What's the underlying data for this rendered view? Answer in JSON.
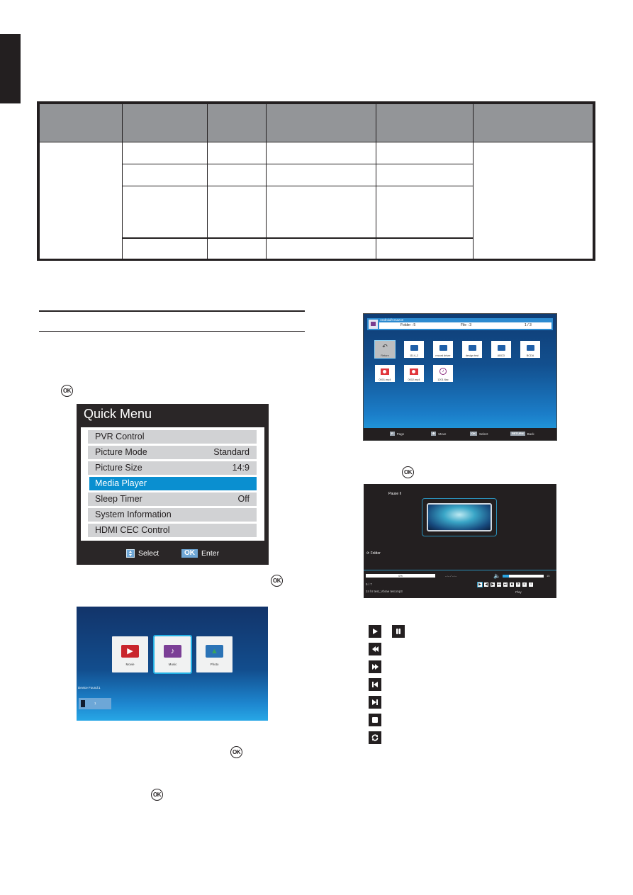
{
  "spec_table": {
    "columns": 6,
    "header": [
      "",
      "",
      "",
      "",
      "",
      ""
    ],
    "rows": [
      [
        "",
        "",
        "",
        "",
        "",
        ""
      ],
      [
        "",
        "",
        "",
        ""
      ],
      [
        "",
        "",
        "",
        ""
      ],
      [
        "",
        "",
        "",
        ""
      ]
    ]
  },
  "quick_menu": {
    "title": "Quick Menu",
    "items": [
      {
        "label": "PVR Control",
        "value": ""
      },
      {
        "label": "Picture Mode",
        "value": "Standard"
      },
      {
        "label": "Picture Size",
        "value": "14:9"
      },
      {
        "label": "Media Player",
        "value": "",
        "selected": true
      },
      {
        "label": "Sleep Timer",
        "value": "Off"
      },
      {
        "label": "System Information",
        "value": ""
      },
      {
        "label": "HDMI CEC Control",
        "value": ""
      }
    ],
    "footer": {
      "select_label": "Select",
      "ok_key": "OK",
      "enter_label": "Enter"
    }
  },
  "ok_key_glyph": "OK",
  "media_home": {
    "cards": [
      {
        "label": "Movie",
        "color": "#c9252c",
        "glyph": "▶"
      },
      {
        "label": "Music",
        "color": "#7b3f96",
        "glyph": "♪",
        "selected": true
      },
      {
        "label": "Photo",
        "color": "#2b73b6",
        "glyph": "▲"
      }
    ],
    "device_found": "Device Found:1",
    "device_number": "1"
  },
  "file_browser": {
    "path": "Android/Amazon",
    "folder_count": "Folder : 5",
    "file_count": "File : 3",
    "page": "1 / 3",
    "items": [
      {
        "type": "return",
        "label": "Return",
        "selected": true
      },
      {
        "type": "folder",
        "label": "1114_2"
      },
      {
        "type": "folder",
        "label": "record driver"
      },
      {
        "type": "folder",
        "label": "design test"
      },
      {
        "type": "folder",
        "label": "ABCD"
      },
      {
        "type": "folder",
        "label": "BCDA"
      },
      {
        "type": "video",
        "label": "0001.mp4"
      },
      {
        "type": "video",
        "label": "0002.mp4"
      },
      {
        "type": "music",
        "label": "1201.flac"
      }
    ],
    "footer": [
      {
        "key": "P",
        "label": "Page"
      },
      {
        "key": "✥",
        "label": "Move"
      },
      {
        "key": "OK",
        "label": "Select"
      },
      {
        "key": "RETURN",
        "label": "Back"
      }
    ]
  },
  "playback": {
    "status": "Pause ‖",
    "folder_label": "Folder",
    "progress_text": "0%",
    "progress": 0,
    "time": "--:-- / --:--",
    "volume": 15,
    "volume_max": 100,
    "volume_text": "15",
    "track_count": "5 / 7",
    "filename": "24 hr test_Vbrae test.mp3",
    "controls": [
      "play",
      "rewind",
      "fast-forward",
      "previous",
      "next",
      "stop",
      "repeat",
      "list",
      "info"
    ],
    "mode_label": "Play"
  },
  "legend_icons": [
    {
      "name": "play",
      "pair": "pause"
    },
    {
      "name": "rewind"
    },
    {
      "name": "fast-forward"
    },
    {
      "name": "previous"
    },
    {
      "name": "next"
    },
    {
      "name": "stop"
    },
    {
      "name": "repeat"
    }
  ]
}
